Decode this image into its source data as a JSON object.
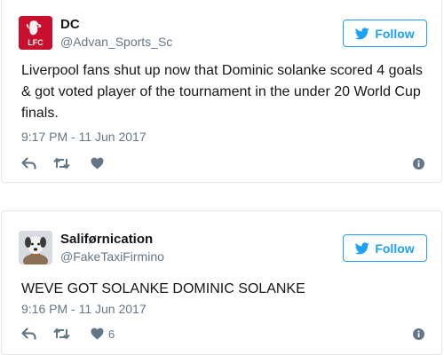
{
  "tweets": [
    {
      "display_name": "DC",
      "handle": "@Advan_Sports_Sc",
      "follow_label": "Follow",
      "avatar_text": "LFC",
      "text": "Liverpool fans shut up now that Dominic solanke scored 4 goals & got voted player of the tournament in the under 20 World Cup finals.",
      "timestamp": "9:17 PM - 11 Jun 2017",
      "like_count": ""
    },
    {
      "display_name": "Saliførnication",
      "handle": "@FakeTaxiFirmino",
      "follow_label": "Follow",
      "text": "WEVE GOT SOLANKE DOMINIC SOLANKE",
      "timestamp": "9:16 PM - 11 Jun 2017",
      "like_count": "6"
    }
  ],
  "colors": {
    "accent": "#1da1f2",
    "muted": "#657786",
    "border": "#e1e8ed",
    "text": "#14171a",
    "liverpool_red": "#c8102e"
  },
  "icons": [
    "liverpool-crest-avatar",
    "dog-avatar",
    "twitter-bird-icon",
    "reply-icon",
    "retweet-icon",
    "heart-icon",
    "info-icon"
  ]
}
